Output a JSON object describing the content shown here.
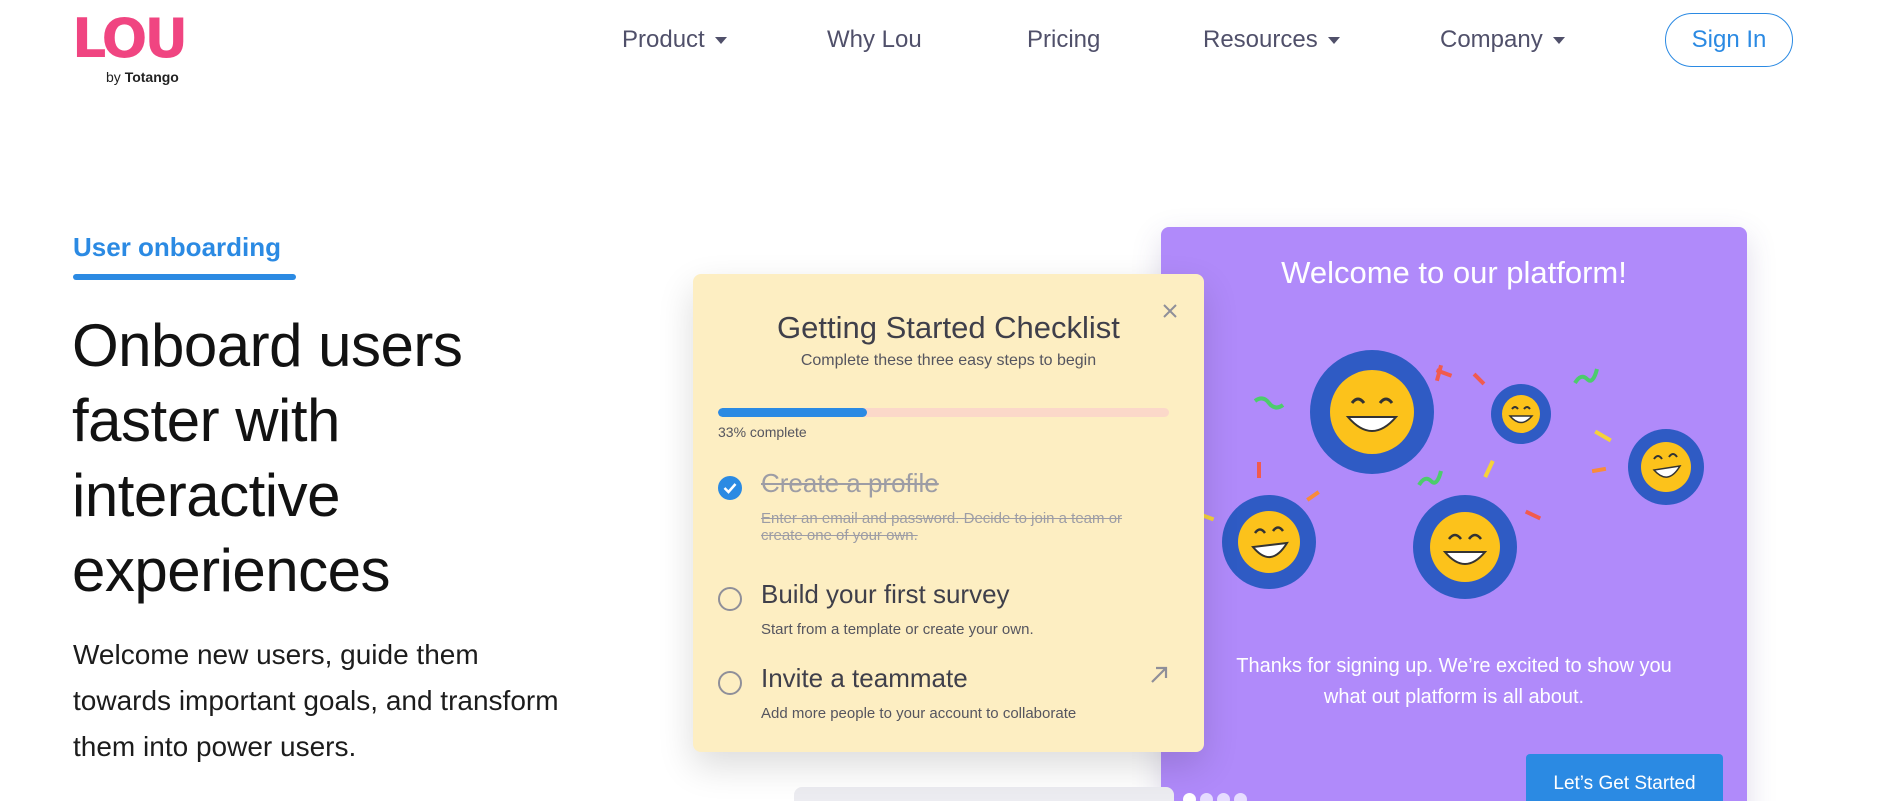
{
  "header": {
    "logo": {
      "word": "LOU",
      "sub_prefix": "by",
      "sub_brand": "Totango",
      "color": "#f04581"
    },
    "nav": [
      {
        "label": "Product",
        "has_dropdown": true
      },
      {
        "label": "Why Lou",
        "has_dropdown": false
      },
      {
        "label": "Pricing",
        "has_dropdown": false
      },
      {
        "label": "Resources",
        "has_dropdown": true
      },
      {
        "label": "Company",
        "has_dropdown": true
      }
    ],
    "signin_label": "Sign In"
  },
  "hero": {
    "eyebrow": "User onboarding",
    "headline_lines": [
      "Onboard users",
      "faster with",
      "interactive",
      "experiences"
    ],
    "subtext_lines": [
      "Welcome new users, guide them",
      "towards important goals, and transform",
      "them into power users."
    ]
  },
  "checklist": {
    "title": "Getting Started Checklist",
    "subtitle": "Complete these three easy steps to begin",
    "progress_fraction": 0.33,
    "progress_label": "33% complete",
    "items": [
      {
        "title": "Create a profile",
        "desc": "Enter an email and password. Decide to join a team or create one of your own.",
        "done": true
      },
      {
        "title": "Build your first survey",
        "desc": "Start from a template or create your own.",
        "done": false
      },
      {
        "title": "Invite a teammate",
        "desc": "Add more people to your account to collaborate",
        "done": false
      }
    ]
  },
  "welcome": {
    "title": "Welcome to our platform!",
    "text_lines": [
      "Thanks for signing up. We’re excited to show you",
      "what out platform is all about."
    ],
    "cta_label": "Let’s Get Started",
    "pager": {
      "count": 4,
      "active": 0
    }
  },
  "colors": {
    "accent": "#2b8ae3",
    "brand_pink": "#f04581",
    "purple_card": "#b08afa",
    "yellow_card": "#fdeec2",
    "emoji_ring": "#2f5bc4",
    "emoji_face": "#fcc21b"
  },
  "icons": [
    "caret-down-icon",
    "close-icon",
    "checkmark-icon",
    "external-arrow-icon",
    "grinning-emoji-icon",
    "confetti-icon"
  ]
}
